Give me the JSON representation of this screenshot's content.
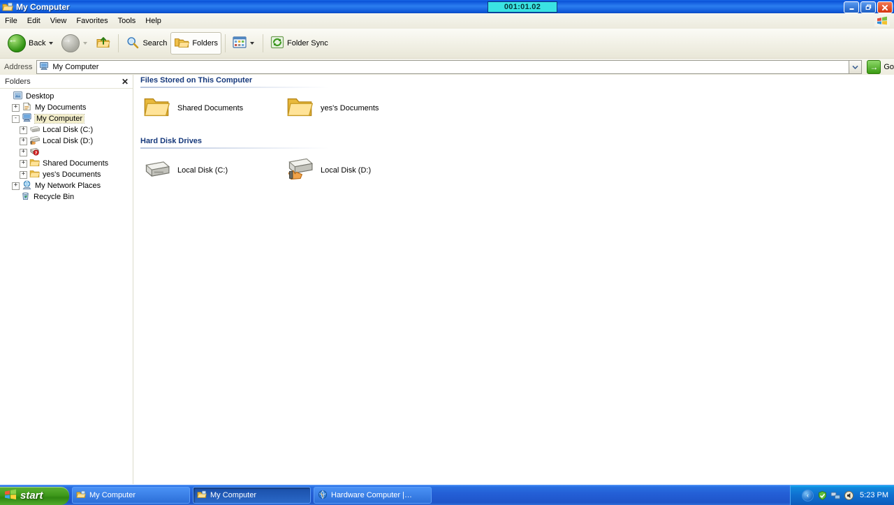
{
  "window": {
    "title": "My Computer",
    "title_icon": "folder-computer-icon",
    "timer": "001:01.02",
    "controls": {
      "minimize": "_",
      "maximize": "❐",
      "close": "✕"
    }
  },
  "menubar": {
    "items": [
      {
        "label": "File"
      },
      {
        "label": "Edit"
      },
      {
        "label": "View"
      },
      {
        "label": "Favorites"
      },
      {
        "label": "Tools"
      },
      {
        "label": "Help"
      }
    ],
    "corner_icon": "windows-flag-icon"
  },
  "toolbar": {
    "back_label": "Back",
    "forward_label": "",
    "up_label": "",
    "search_label": "Search",
    "folders_label": "Folders",
    "views_label": "",
    "folder_sync_label": "Folder Sync"
  },
  "address": {
    "label": "Address",
    "value": "My Computer",
    "icon": "my-computer-icon",
    "go_label": "Go"
  },
  "folders_pane": {
    "header": "Folders",
    "close": "✕",
    "tree": [
      {
        "label": "Desktop",
        "indent": 0,
        "expander": "",
        "icon": "desktop-icon",
        "selected": false
      },
      {
        "label": "My Documents",
        "indent": 1,
        "expander": "+",
        "icon": "my-documents-icon",
        "selected": false
      },
      {
        "label": "My Computer",
        "indent": 1,
        "expander": "-",
        "icon": "my-computer-icon",
        "selected": true
      },
      {
        "label": "Local Disk (C:)",
        "indent": 2,
        "expander": "+",
        "icon": "hard-drive-icon",
        "selected": false
      },
      {
        "label": "Local Disk (D:)",
        "indent": 2,
        "expander": "+",
        "icon": "hard-drive-shared-icon",
        "selected": false
      },
      {
        "label": "",
        "indent": 2,
        "expander": "+",
        "icon": "unknown-device-icon",
        "selected": false
      },
      {
        "label": "Shared Documents",
        "indent": 2,
        "expander": "+",
        "icon": "folder-icon",
        "selected": false
      },
      {
        "label": "yes's Documents",
        "indent": 2,
        "expander": "+",
        "icon": "folder-icon",
        "selected": false
      },
      {
        "label": "My Network Places",
        "indent": 1,
        "expander": "+",
        "icon": "network-icon",
        "selected": false
      },
      {
        "label": "Recycle Bin",
        "indent": 1,
        "expander": "",
        "icon": "recycle-bin-icon",
        "selected": false
      }
    ]
  },
  "content": {
    "groups": [
      {
        "title": "Files Stored on This Computer",
        "items": [
          {
            "label": "Shared Documents",
            "icon": "folder-icon"
          },
          {
            "label": "yes's Documents",
            "icon": "folder-icon"
          }
        ]
      },
      {
        "title": "Hard Disk Drives",
        "items": [
          {
            "label": "Local Disk (C:)",
            "icon": "hard-drive-icon"
          },
          {
            "label": "Local Disk (D:)",
            "icon": "hard-drive-shared-icon"
          }
        ]
      }
    ]
  },
  "taskbar": {
    "start_label": "start",
    "items": [
      {
        "label": "My Computer",
        "icon": "folder-computer-icon",
        "active": false
      },
      {
        "label": "My Computer",
        "icon": "folder-computer-icon",
        "active": true
      },
      {
        "label": "Hardware Computer |…",
        "icon": "browser-icon",
        "active": false
      }
    ],
    "tray": {
      "chevron": "‹",
      "icons": [
        "shield-icon",
        "network-icon",
        "volume-icon"
      ],
      "time": "5:23 PM"
    }
  },
  "colors": {
    "titlebar_blue": "#0a52d8",
    "timer_cyan": "#3ae3e3",
    "group_heading": "#15387b",
    "folder_yellow": "#f5d67a",
    "start_green": "#3f9a1c"
  }
}
